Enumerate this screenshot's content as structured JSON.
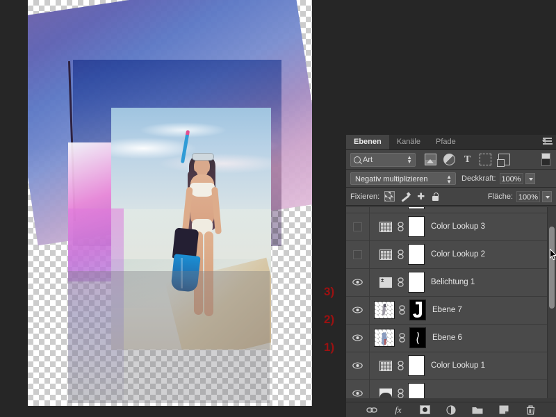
{
  "app": {
    "title": "Adobe Photoshop - Ebenen-Bedienfeld",
    "accent_red": "#9c1111",
    "panel_bg": "#3b3b3b",
    "list_bg": "#4a4a4a",
    "selected_row_bg": "#565656"
  },
  "panel": {
    "tabs": [
      {
        "label": "Ebenen",
        "active": true
      },
      {
        "label": "Kanäle",
        "active": false
      },
      {
        "label": "Pfade",
        "active": false
      }
    ],
    "menu_icon": "panel-menu-icon",
    "filter": {
      "kind_label": "Art",
      "icons": [
        "pixel-layer-filter-icon",
        "adjustment-layer-filter-icon",
        "type-layer-filter-icon",
        "shape-layer-filter-icon",
        "smart-object-filter-icon"
      ],
      "toggle_icon": "filter-toggle-icon"
    },
    "blend": {
      "mode": "Negativ multiplizieren",
      "opacity_label": "Deckkraft:",
      "opacity_value": "100%"
    },
    "lock": {
      "label": "Fixieren:",
      "icons": [
        "lock-transparency-icon",
        "lock-image-pixels-icon",
        "lock-position-icon",
        "lock-all-icon"
      ],
      "fill_label": "Fläche:",
      "fill_value": "100%"
    },
    "bottom_buttons": [
      {
        "name": "link-layers-button",
        "glyph": "∞"
      },
      {
        "name": "layer-style-fx-button",
        "glyph": "fx"
      },
      {
        "name": "add-layer-mask-button",
        "glyph": "▣"
      },
      {
        "name": "new-adjustment-layer-button",
        "glyph": "◑"
      },
      {
        "name": "new-group-button",
        "glyph": "▭"
      },
      {
        "name": "new-layer-button",
        "glyph": "❐"
      },
      {
        "name": "delete-layer-button",
        "glyph": "Ὕ1"
      }
    ],
    "scrollbar": {
      "name": "layers-scrollbar"
    }
  },
  "layers": [
    {
      "name": "",
      "visible": true,
      "type": "adjustment",
      "icon": "adjustment-thumbnail-icon",
      "has_mask": true,
      "linked": true,
      "selected": false,
      "partial": "top"
    },
    {
      "name": "Color Lookup 3",
      "visible": false,
      "type": "color-lookup",
      "icon": "color-lookup-icon",
      "has_mask": true,
      "linked": true,
      "selected": false,
      "annotation": ""
    },
    {
      "name": "Color Lookup 2",
      "visible": false,
      "type": "color-lookup",
      "icon": "color-lookup-icon",
      "has_mask": true,
      "linked": true,
      "selected": false,
      "annotation": ""
    },
    {
      "name": "Belichtung 1",
      "visible": true,
      "type": "exposure",
      "icon": "exposure-icon",
      "has_mask": true,
      "linked": true,
      "selected": false,
      "annotation": "3)"
    },
    {
      "name": "Ebene 7",
      "visible": true,
      "type": "pixel",
      "icon": "pixel-thumbnail-icon",
      "has_mask": true,
      "mask_style": "black-with-white-hook",
      "linked": true,
      "selected": false,
      "annotation": "2)"
    },
    {
      "name": "Ebene 6",
      "visible": true,
      "type": "pixel",
      "icon": "pixel-thumbnail-icon",
      "has_mask": true,
      "mask_style": "black-with-white-stroke",
      "linked": true,
      "selected": false,
      "annotation": "1)"
    },
    {
      "name": "Color Lookup 1",
      "visible": true,
      "type": "color-lookup",
      "icon": "color-lookup-icon",
      "has_mask": true,
      "linked": true,
      "selected": false,
      "annotation": ""
    },
    {
      "name": "",
      "visible": true,
      "type": "gradient-map",
      "icon": "gradient-map-icon",
      "has_mask": true,
      "linked": true,
      "selected": false,
      "partial": "bottom"
    }
  ],
  "canvas": {
    "name": "document-canvas",
    "transparency_checker": true,
    "description": "Strandfoto-Montage mit rotierter Himmelsebene"
  }
}
